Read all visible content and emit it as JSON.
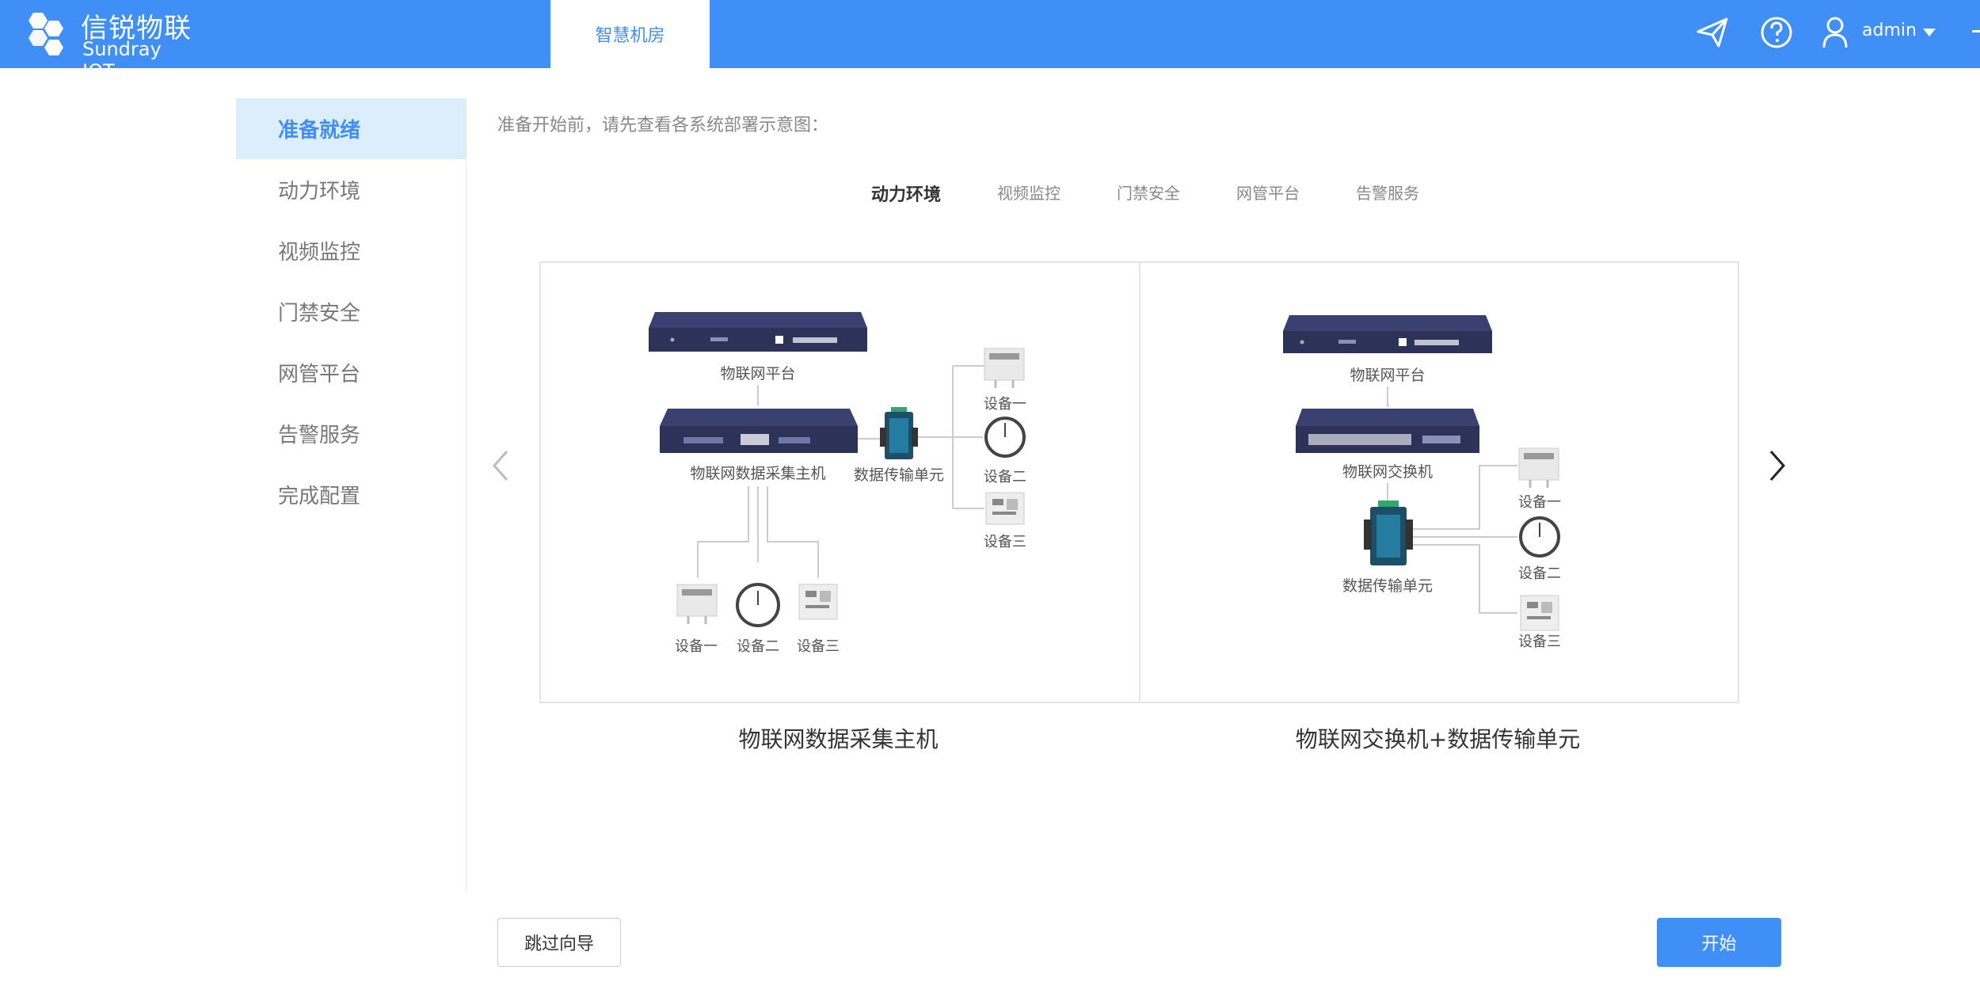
{
  "brand": {
    "name_cn": "信锐物联",
    "name_en": "Sundray IOT"
  },
  "header": {
    "nav_tab": "智慧机房",
    "user": "admin",
    "icons": [
      "send-icon",
      "help-icon",
      "user-icon",
      "chevron-down-icon"
    ]
  },
  "sidebar": {
    "items": [
      {
        "label": "准备就绪",
        "active": true
      },
      {
        "label": "动力环境"
      },
      {
        "label": "视频监控"
      },
      {
        "label": "门禁安全"
      },
      {
        "label": "网管平台"
      },
      {
        "label": "告警服务"
      },
      {
        "label": "完成配置"
      }
    ]
  },
  "main": {
    "intro": "准备开始前，请先查看各系统部署示意图：",
    "tabs": [
      {
        "label": "动力环境",
        "active": true
      },
      {
        "label": "视频监控"
      },
      {
        "label": "门禁安全"
      },
      {
        "label": "网管平台"
      },
      {
        "label": "告警服务"
      }
    ],
    "diagram_left": {
      "caption": "物联网数据采集主机",
      "labels": {
        "platform": "物联网平台",
        "host": "物联网数据采集主机",
        "dtu": "数据传输单元",
        "dev1": "设备一",
        "dev2": "设备二",
        "dev3": "设备三"
      }
    },
    "diagram_right": {
      "caption": "物联网交换机+数据传输单元",
      "labels": {
        "platform": "物联网平台",
        "switch": "物联网交换机",
        "dtu": "数据传输单元",
        "dev1": "设备一",
        "dev2": "设备二",
        "dev3": "设备三"
      }
    }
  },
  "footer": {
    "skip": "跳过向导",
    "start": "开始"
  },
  "colors": {
    "accent": "#3f8ff7",
    "active_bg": "#dcedfc",
    "device_navy": "#2c3258"
  }
}
